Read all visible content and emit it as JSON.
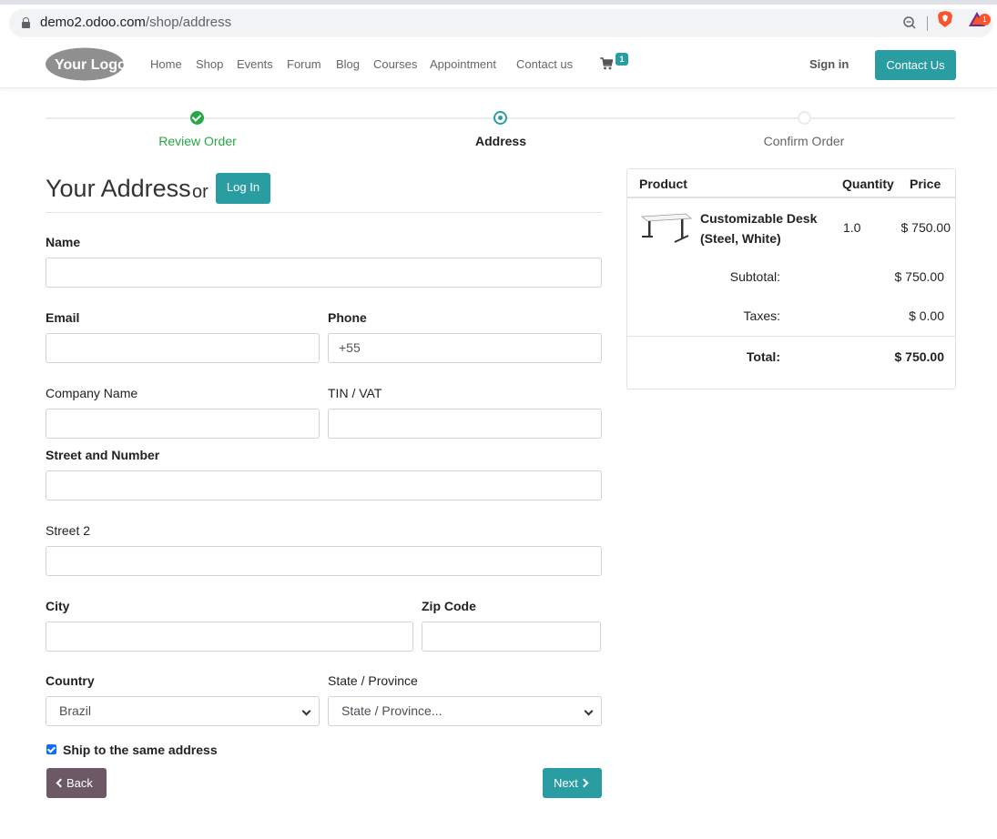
{
  "browser": {
    "url_domain": "demo2.odoo.com",
    "url_path": "/shop/address",
    "rewards_badge": "1"
  },
  "nav": {
    "logo_text": "Your Logo",
    "items": [
      "Home",
      "Shop",
      "Events",
      "Forum",
      "Blog",
      "Courses",
      "Appointment",
      "Contact us"
    ],
    "cart_count": "1",
    "signin": "Sign in",
    "contact_button": "Contact Us"
  },
  "progress": {
    "steps": [
      {
        "label": "Review Order",
        "state": "done"
      },
      {
        "label": "Address",
        "state": "active"
      },
      {
        "label": "Confirm Order",
        "state": "todo"
      }
    ],
    "colors": {
      "done": "#28a745",
      "active": "#2a9da3",
      "todo": "#666666"
    }
  },
  "form": {
    "title": "Your Address",
    "or": "or",
    "login_button": "Log In",
    "labels": {
      "name": "Name",
      "email": "Email",
      "phone": "Phone",
      "company": "Company Name",
      "vat": "TIN / VAT",
      "street": "Street and Number",
      "street2": "Street 2",
      "city": "City",
      "zip": "Zip Code",
      "country": "Country",
      "state": "State / Province"
    },
    "values": {
      "name": "",
      "email": "",
      "phone": "+55",
      "company": "",
      "vat": "",
      "street": "",
      "street2": "",
      "city": "",
      "zip": ""
    },
    "country_selected": "Brazil",
    "state_selected": "State / Province...",
    "ship_same_label": "Ship to the same address",
    "ship_same_checked": true,
    "back_button": "Back",
    "next_button": "Next"
  },
  "summary": {
    "headers": {
      "product": "Product",
      "quantity": "Quantity",
      "price": "Price"
    },
    "items": [
      {
        "name": "Customizable Desk (Steel, White)",
        "quantity": "1.0",
        "price": "$ 750.00"
      }
    ],
    "subtotal_label": "Subtotal:",
    "subtotal": "$ 750.00",
    "taxes_label": "Taxes:",
    "taxes": "$ 0.00",
    "total_label": "Total:",
    "total": "$ 750.00"
  },
  "theme": {
    "primary": "#2a9da3",
    "back_button": "#6d5866",
    "success": "#28a745"
  }
}
